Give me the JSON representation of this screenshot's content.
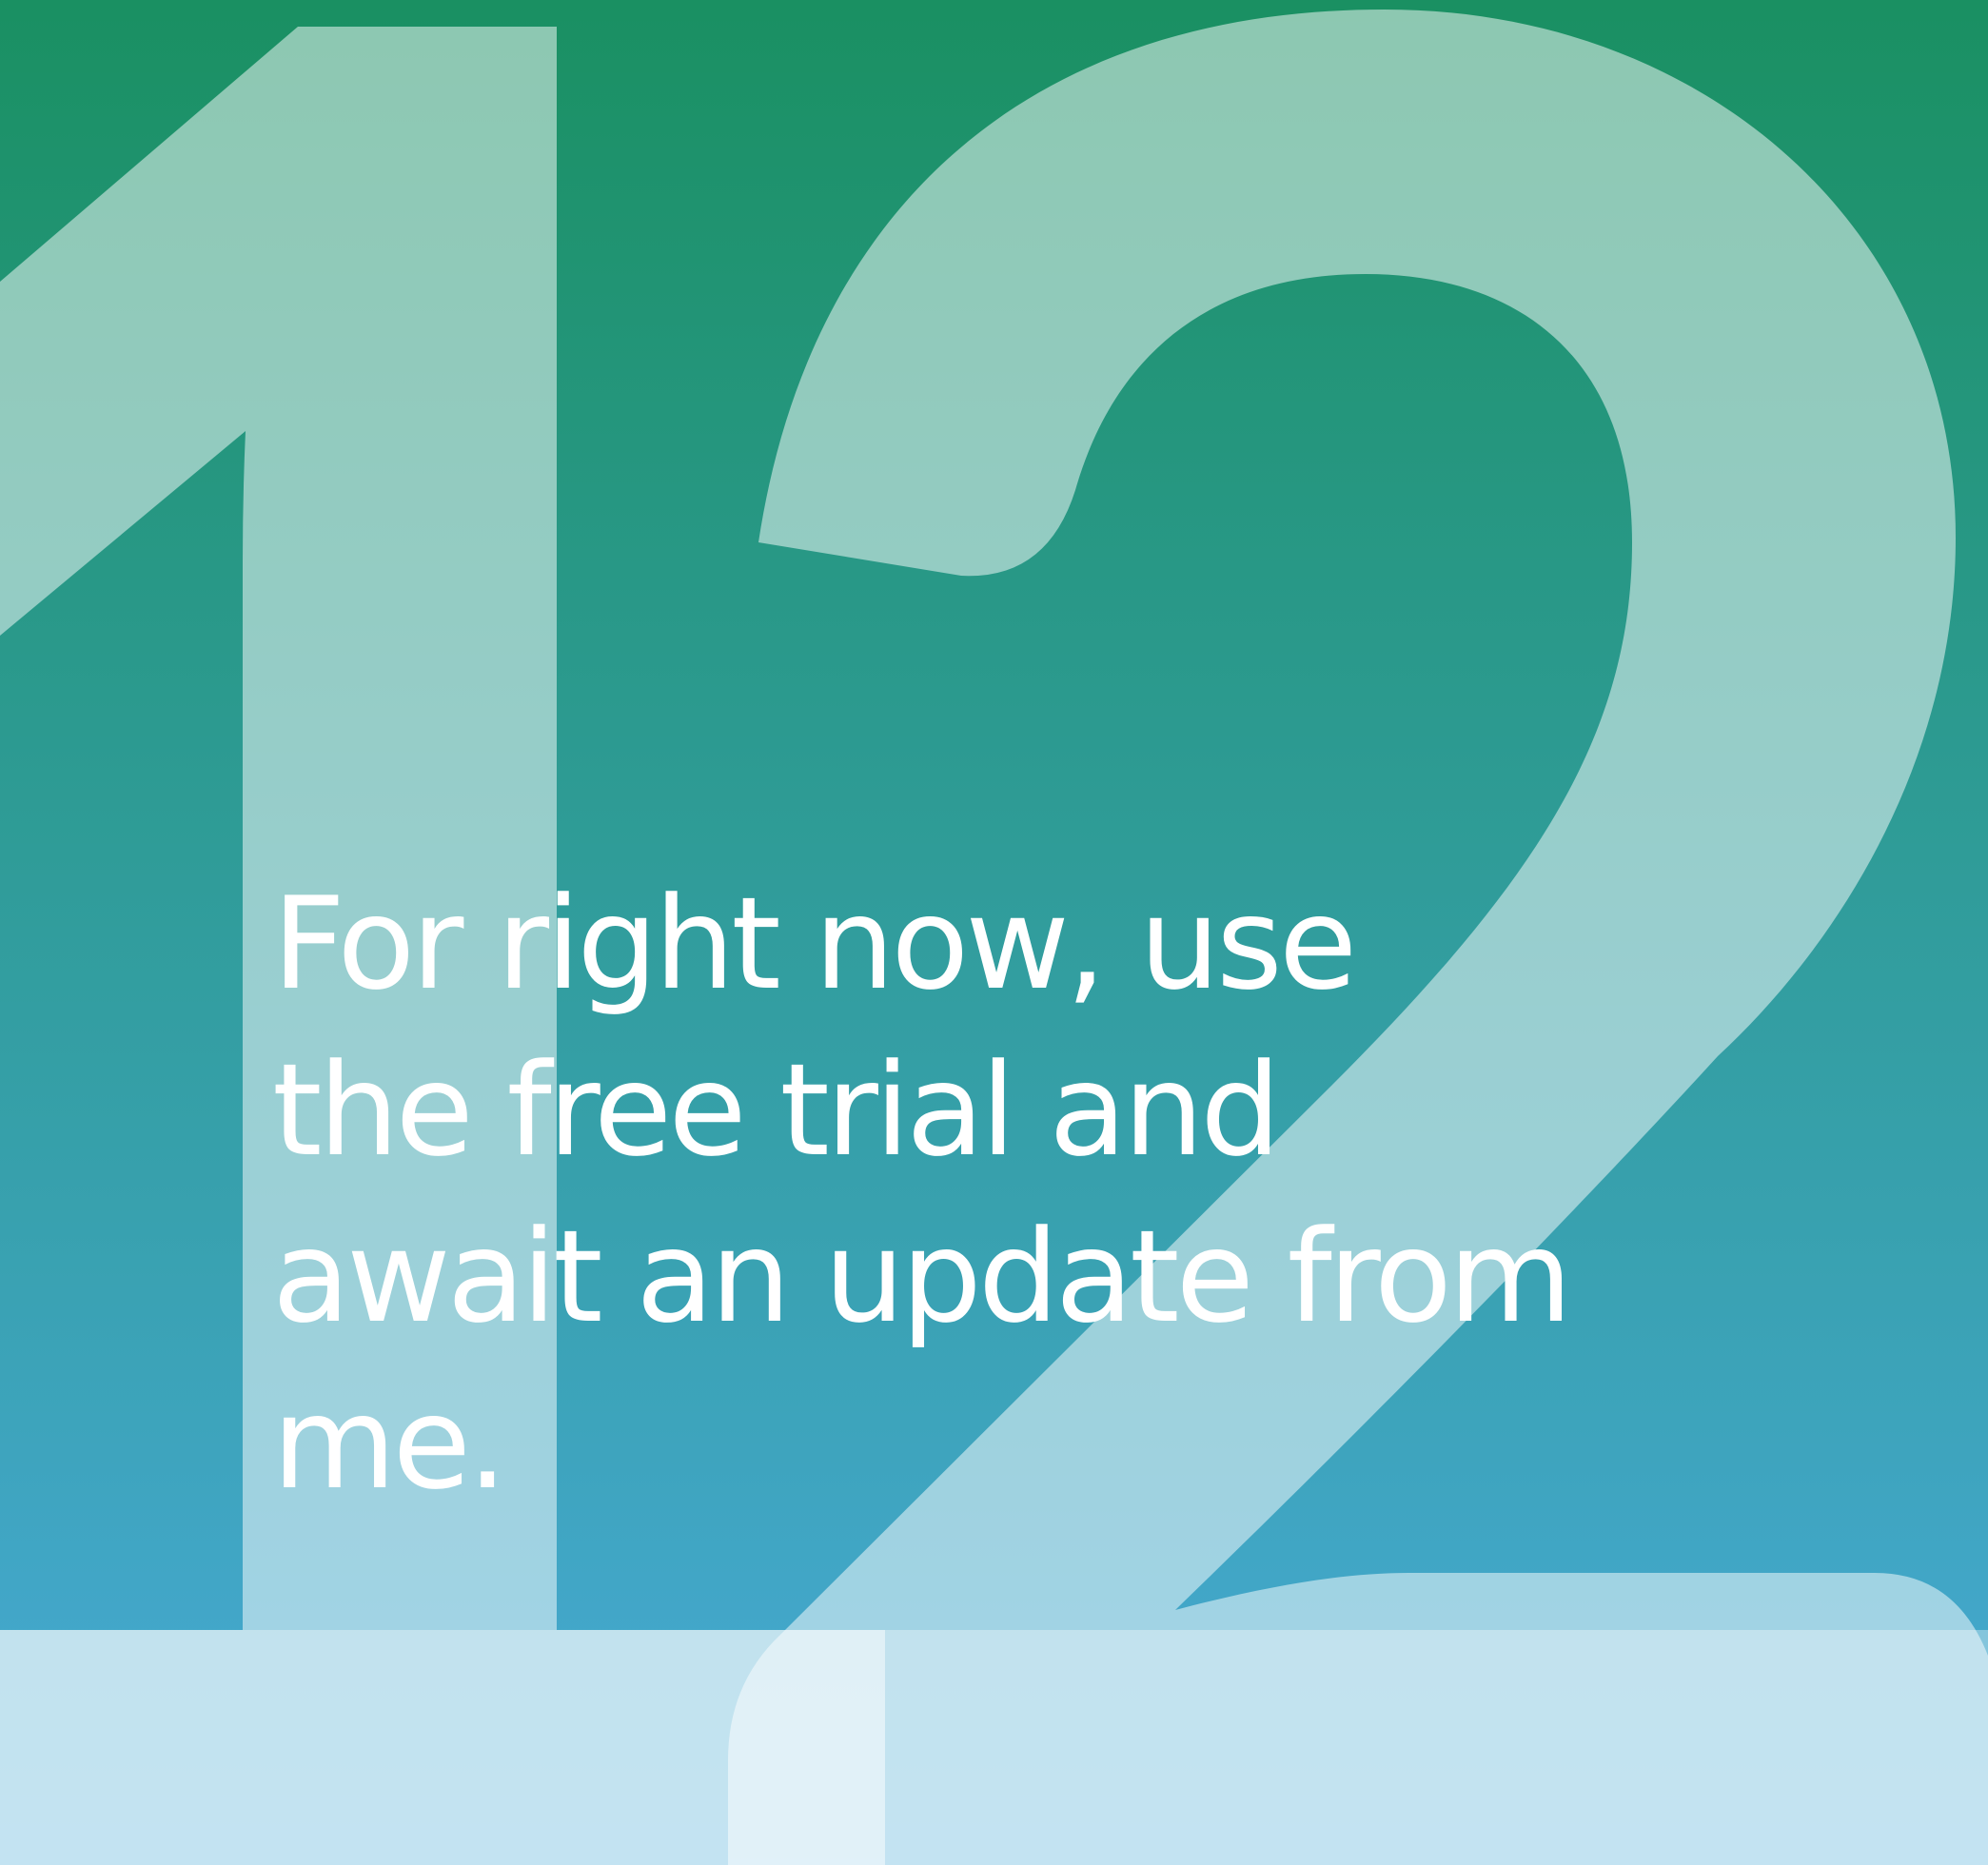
{
  "background": {
    "gradient_top": "#1a9062",
    "gradient_bottom": "#48aad8",
    "numeral_color": "#ffffff"
  },
  "numeral": "12",
  "message": {
    "lines": [
      "For right now, use",
      "the free trial and",
      "await an update from",
      "me."
    ]
  }
}
